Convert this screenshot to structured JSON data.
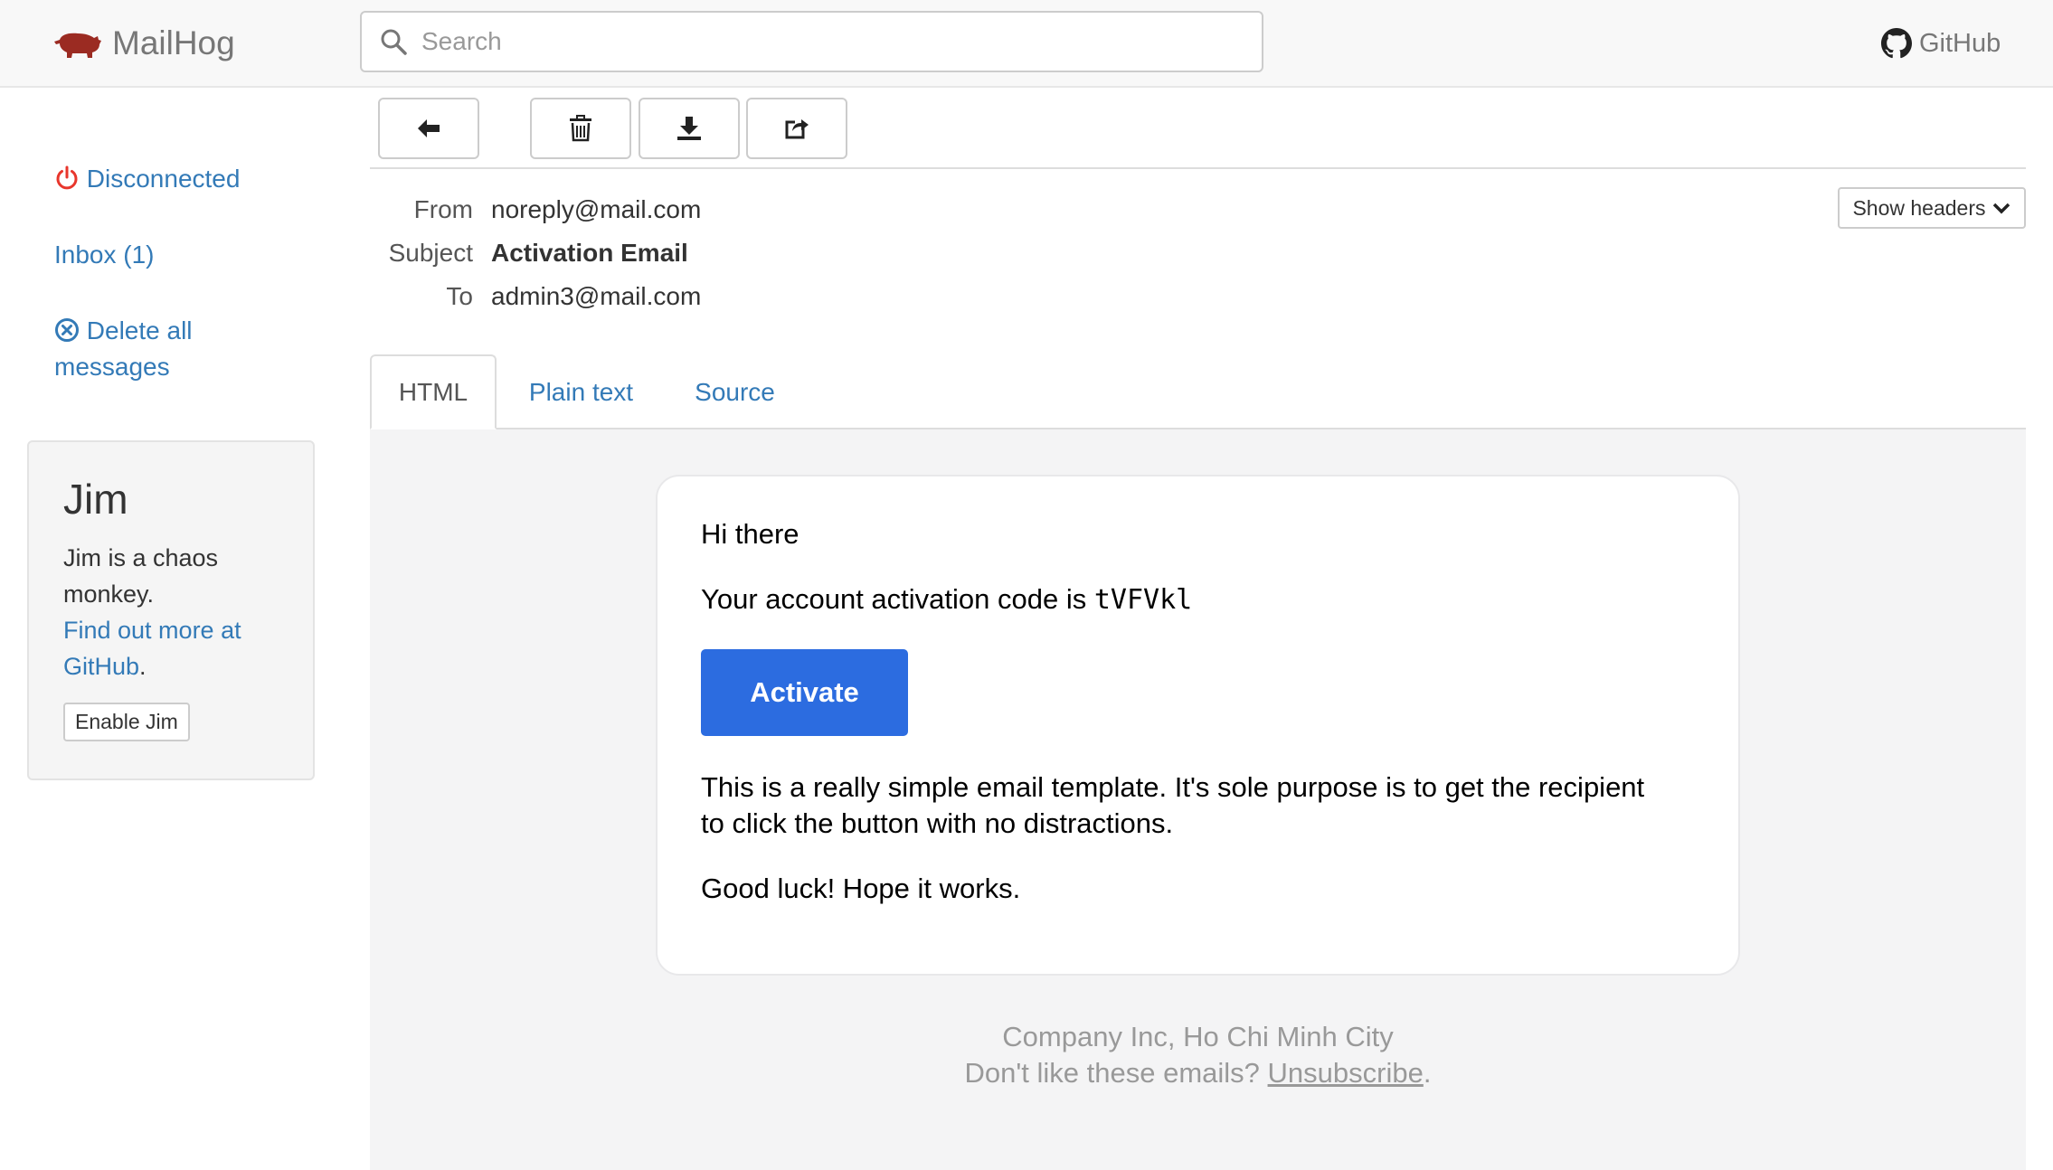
{
  "navbar": {
    "brand": "MailHog",
    "search_placeholder": "Search",
    "github_label": "GitHub"
  },
  "sidebar": {
    "status": "Disconnected",
    "inbox": "Inbox (1)",
    "delete_all_line1": "Delete all",
    "delete_all_line2": "messages"
  },
  "jim": {
    "title": "Jim",
    "description_line1": "Jim is a chaos",
    "description_line2": "monkey.",
    "link_line1": "Find out more at",
    "link_line2": "GitHub",
    "link_suffix": ".",
    "button": "Enable Jim"
  },
  "toolbar": {
    "icons": [
      "back-arrow-icon",
      "trash-icon",
      "download-icon",
      "share-icon"
    ]
  },
  "message": {
    "from_label": "From",
    "from": "noreply@mail.com",
    "subject_label": "Subject",
    "subject": "Activation Email",
    "to_label": "To",
    "to": "admin3@mail.com",
    "show_headers": "Show headers"
  },
  "tabs": {
    "html": "HTML",
    "plain": "Plain text",
    "source": "Source",
    "active": "HTML"
  },
  "email": {
    "greeting": "Hi there",
    "code_prefix": "Your account activation code is ",
    "code": "tVFVkl",
    "button": "Activate",
    "body_line1": "This is a really simple email template. It's sole purpose is to get the recipient",
    "body_line2": "to click the button with no distractions.",
    "signoff": "Good luck! Hope it works.",
    "footer_line1": "Company Inc, Ho Chi Minh City",
    "footer_prefix": "Don't like these emails? ",
    "footer_link": "Unsubscribe",
    "footer_suffix": "."
  },
  "colors": {
    "link": "#337ab7",
    "brand_pig": "#9b2b22",
    "disconnected": "#e8362c",
    "activate_button": "#2c6ce0"
  }
}
